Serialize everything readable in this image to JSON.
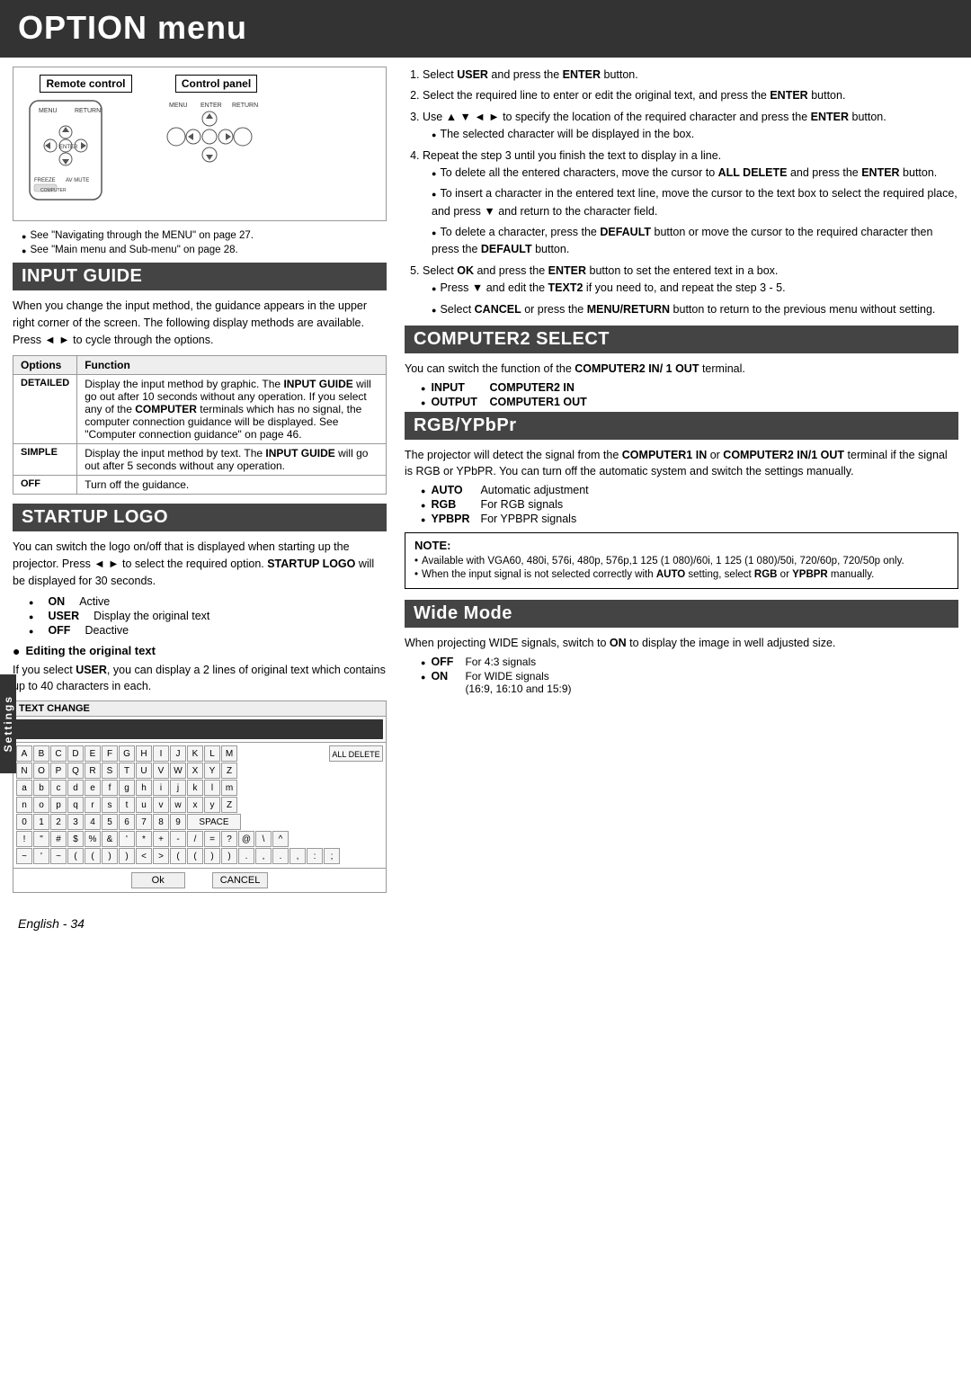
{
  "header": {
    "title": "OPTION menu"
  },
  "remote_control": {
    "label": "Remote control",
    "control_panel_label": "Control panel",
    "note1": "See \"Navigating through the MENU\" on page 27.",
    "note2": "See \"Main menu and Sub-menu\" on page 28."
  },
  "input_guide": {
    "section_title": "INPUT GUIDE",
    "body_text": "When you change the input method, the guidance appears in the upper right corner of the screen. The following display methods are available. Press ◄ ► to cycle through the options.",
    "table": {
      "col1": "Options",
      "col2": "Function",
      "rows": [
        {
          "option": "DETAILED",
          "function": "Display the input method by graphic. The INPUT GUIDE will go out after 10 seconds without any operation. If you select any of the COMPUTER terminals which has no signal, the computer connection guidance will be displayed. See \"Computer connection guidance\" on page 46."
        },
        {
          "option": "SIMPLE",
          "function": "Display the input method by text. The INPUT GUIDE will go out after 5 seconds without any operation."
        },
        {
          "option": "OFF",
          "function": "Turn off the guidance."
        }
      ]
    }
  },
  "startup_logo": {
    "section_title": "STARTUP LOGO",
    "body_text": "You can switch the logo on/off that is displayed when starting up the projector. Press ◄ ► to select the required option. STARTUP LOGO will be displayed for 30 seconds.",
    "items": [
      {
        "label": "ON",
        "value": "Active"
      },
      {
        "label": "USER",
        "value": "Display the original text"
      },
      {
        "label": "OFF",
        "value": "Deactive"
      }
    ],
    "editing_title": "Editing the original text",
    "editing_text": "If you select USER, you can display a 2 lines of original text which contains up to 40 characters in each.",
    "text_change": {
      "title": "TEXT CHANGE",
      "input_placeholder": "",
      "all_delete": "ALL DELETE",
      "rows": [
        [
          "A",
          "B",
          "C",
          "D",
          "E",
          "F",
          "G",
          "H",
          "I",
          "J",
          "K",
          "L",
          "M"
        ],
        [
          "N",
          "O",
          "P",
          "Q",
          "R",
          "S",
          "T",
          "U",
          "V",
          "W",
          "X",
          "Y",
          "Z"
        ],
        [
          "a",
          "b",
          "c",
          "d",
          "e",
          "f",
          "g",
          "h",
          "i",
          "j",
          "k",
          "l",
          "m"
        ],
        [
          "n",
          "o",
          "p",
          "q",
          "r",
          "s",
          "t",
          "u",
          "v",
          "w",
          "x",
          "y",
          "Z"
        ],
        [
          "0",
          "1",
          "2",
          "3",
          "4",
          "5",
          "6",
          "7",
          "8",
          "9",
          "SPACE"
        ],
        [
          "!",
          "\"",
          "#",
          "$",
          "%",
          "&",
          "'",
          "*",
          "+",
          "-",
          "/",
          "=",
          "?",
          "@",
          "\\",
          "^"
        ],
        [
          "~",
          "'",
          "~",
          "(",
          "(",
          ")",
          ")",
          "<",
          ">",
          "(",
          "(",
          ")",
          ")",
          ".",
          ",",
          ".",
          ",",
          ":",
          ";"
        ]
      ],
      "ok_label": "Ok",
      "cancel_label": "CANCEL"
    }
  },
  "right_col": {
    "instructions": [
      "Select USER and press the ENTER button.",
      "Select the required line to enter or edit the original text, and press the ENTER button.",
      "Use ▲ ▼ ◄ ► to specify the location of the required character and press the ENTER button.",
      "Repeat the step 3 until you finish the text to display in a line.",
      "Select OK and press the ENTER button to set the entered text in a box."
    ],
    "instruction_bullets": {
      "step3": "The selected character will be displayed in the box.",
      "step4_1": "To delete all the entered characters, move the cursor to ALL DELETE and press the ENTER button.",
      "step4_2": "To insert a character in the entered text line, move the cursor to the text box to select the required place, and press ▼ and return to the character field.",
      "step4_3": "To delete a character, press the DEFAULT button or move the cursor to the required character then press the DEFAULT button.",
      "step5_1": "Press ▼ and edit the TEXT2 if you need to, and repeat the step 3 - 5.",
      "step5_2": "Select CANCEL or press the MENU/RETURN button to return to the previous menu without setting."
    }
  },
  "computer2_select": {
    "section_title": "COMPUTER2 SELECT",
    "body_text": "You can switch the function of the COMPUTER2 IN/ 1 OUT terminal.",
    "items": [
      {
        "label": "INPUT",
        "value": "COMPUTER2 IN"
      },
      {
        "label": "OUTPUT",
        "value": "COMPUTER1 OUT"
      }
    ]
  },
  "rgb_ypbpr": {
    "section_title": "RGB/YPbPr",
    "body_text": "The projector will detect the signal from the COMPUTER1 IN or COMPUTER2 IN/1 OUT terminal if the signal is RGB or YPbPR. You can turn off the automatic system and switch the settings manually.",
    "items": [
      {
        "label": "AUTO",
        "value": "Automatic adjustment"
      },
      {
        "label": "RGB",
        "value": "For RGB signals"
      },
      {
        "label": "YPBPR",
        "value": "For YPBPR signals"
      }
    ],
    "note": {
      "title": "NOTE:",
      "bullets": [
        "Available with VGA60, 480i, 576i, 480p, 576p,1 125 (1 080)/60i, 1 125 (1 080)/50i, 720/60p, 720/50p only.",
        "When the input signal is not selected correctly with AUTO setting, select RGB or YPBPR manually."
      ]
    }
  },
  "wide_mode": {
    "section_title": "Wide Mode",
    "body_text": "When projecting WIDE signals, switch to ON to display the image in well adjusted size.",
    "items": [
      {
        "label": "OFF",
        "value": "For 4:3 signals"
      },
      {
        "label": "ON",
        "value": "For WIDE signals (16:9, 16:10 and 15:9)"
      }
    ]
  },
  "settings_sidebar": {
    "label": "Settings"
  },
  "footer": {
    "text": "English - 34"
  }
}
